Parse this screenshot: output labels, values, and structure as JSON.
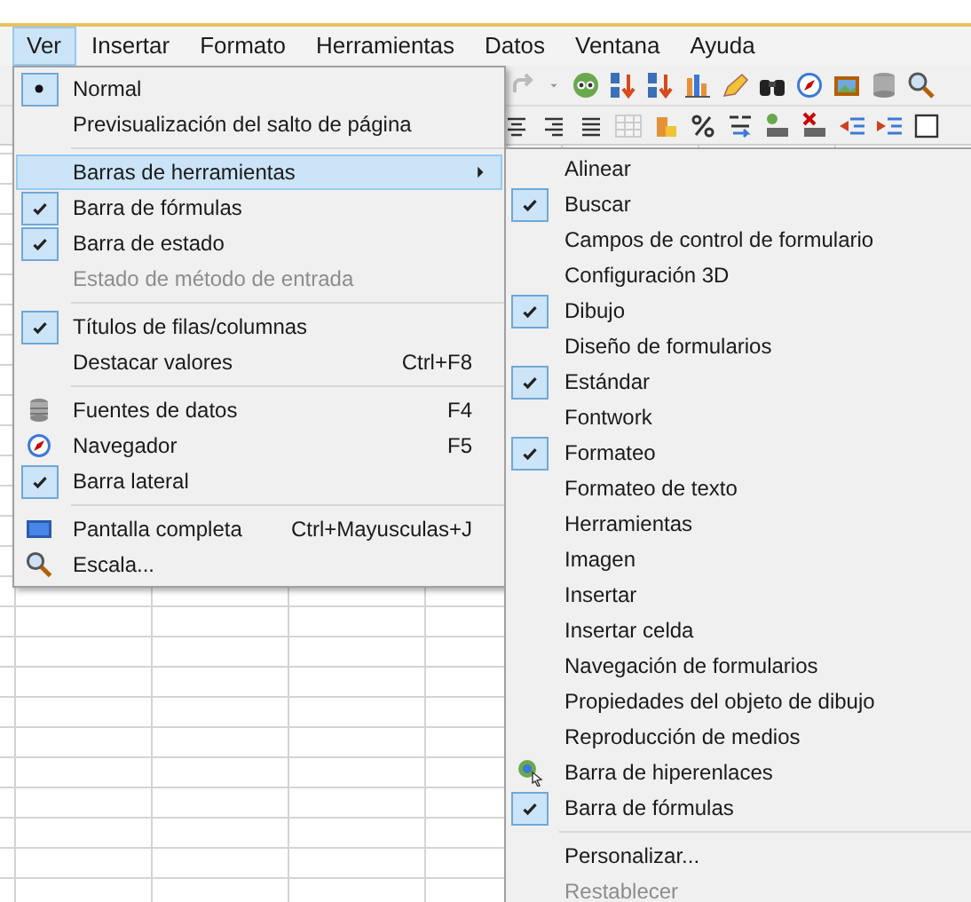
{
  "menubar": [
    {
      "label": "Ver",
      "selected": true
    },
    {
      "label": "Insertar",
      "selected": false
    },
    {
      "label": "Formato",
      "selected": false
    },
    {
      "label": "Herramientas",
      "selected": false
    },
    {
      "label": "Datos",
      "selected": false
    },
    {
      "label": "Ventana",
      "selected": false
    },
    {
      "label": "Ayuda",
      "selected": false
    }
  ],
  "view_menu": {
    "sections": [
      {
        "items": [
          {
            "kind": "radio",
            "label": "Normal",
            "checked": true,
            "disabled": false,
            "selected": false
          },
          {
            "kind": "radio",
            "label": "Previsualización del salto de página",
            "checked": false,
            "disabled": false,
            "selected": false
          }
        ]
      },
      {
        "items": [
          {
            "kind": "submenu",
            "label": "Barras de herramientas",
            "checked": false,
            "disabled": false,
            "selected": true
          },
          {
            "kind": "check",
            "label": "Barra de fórmulas",
            "checked": true,
            "disabled": false,
            "selected": false
          },
          {
            "kind": "check",
            "label": "Barra de estado",
            "checked": true,
            "disabled": false,
            "selected": false
          },
          {
            "kind": "check",
            "label": "Estado de método de entrada",
            "checked": false,
            "disabled": true,
            "selected": false
          }
        ]
      },
      {
        "items": [
          {
            "kind": "check",
            "label": "Títulos de filas/columnas",
            "checked": true,
            "disabled": false,
            "selected": false
          },
          {
            "kind": "check",
            "label": "Destacar valores",
            "shortcut": "Ctrl+F8",
            "checked": false,
            "disabled": false,
            "selected": false
          }
        ]
      },
      {
        "items": [
          {
            "kind": "icon",
            "label": "Fuentes de datos",
            "shortcut": "F4",
            "checked": false,
            "disabled": false,
            "selected": false
          },
          {
            "kind": "icon",
            "label": "Navegador",
            "shortcut": "F5",
            "checked": false,
            "disabled": false,
            "selected": false
          },
          {
            "kind": "check",
            "label": "Barra lateral",
            "checked": true,
            "disabled": false,
            "selected": false
          }
        ]
      },
      {
        "items": [
          {
            "kind": "icon",
            "label": "Pantalla completa",
            "shortcut": "Ctrl+Mayusculas+J",
            "checked": false,
            "disabled": false,
            "selected": false
          },
          {
            "kind": "icon",
            "label": "Escala...",
            "checked": false,
            "disabled": false,
            "selected": false
          }
        ]
      }
    ]
  },
  "toolbars_submenu": {
    "sections": [
      {
        "items": [
          {
            "kind": "check",
            "label": "Alinear",
            "checked": false,
            "disabled": false
          },
          {
            "kind": "check",
            "label": "Buscar",
            "checked": true,
            "disabled": false
          },
          {
            "kind": "check",
            "label": "Campos de control de formulario",
            "checked": false,
            "disabled": false
          },
          {
            "kind": "check",
            "label": "Configuración 3D",
            "checked": false,
            "disabled": false
          },
          {
            "kind": "check",
            "label": "Dibujo",
            "checked": true,
            "disabled": false
          },
          {
            "kind": "check",
            "label": "Diseño de formularios",
            "checked": false,
            "disabled": false
          },
          {
            "kind": "check",
            "label": "Estándar",
            "checked": true,
            "disabled": false
          },
          {
            "kind": "check",
            "label": "Fontwork",
            "checked": false,
            "disabled": false
          },
          {
            "kind": "check",
            "label": "Formateo",
            "checked": true,
            "disabled": false
          },
          {
            "kind": "check",
            "label": "Formateo de texto",
            "checked": false,
            "disabled": false
          },
          {
            "kind": "check",
            "label": "Herramientas",
            "checked": false,
            "disabled": false
          },
          {
            "kind": "check",
            "label": "Imagen",
            "checked": false,
            "disabled": false
          },
          {
            "kind": "check",
            "label": "Insertar",
            "checked": false,
            "disabled": false
          },
          {
            "kind": "check",
            "label": "Insertar celda",
            "checked": false,
            "disabled": false
          },
          {
            "kind": "check",
            "label": "Navegación de formularios",
            "checked": false,
            "disabled": false
          },
          {
            "kind": "check",
            "label": "Propiedades del objeto de dibujo",
            "checked": false,
            "disabled": false
          },
          {
            "kind": "check",
            "label": "Reproducción de medios",
            "checked": false,
            "disabled": false
          },
          {
            "kind": "icon",
            "label": "Barra de hiperenlaces",
            "checked": false,
            "disabled": false
          },
          {
            "kind": "check",
            "label": "Barra de fórmulas",
            "checked": true,
            "disabled": false
          }
        ]
      },
      {
        "items": [
          {
            "kind": "plain",
            "label": "Personalizar...",
            "checked": false,
            "disabled": false
          },
          {
            "kind": "plain",
            "label": "Restablecer",
            "checked": false,
            "disabled": true
          }
        ]
      }
    ]
  }
}
